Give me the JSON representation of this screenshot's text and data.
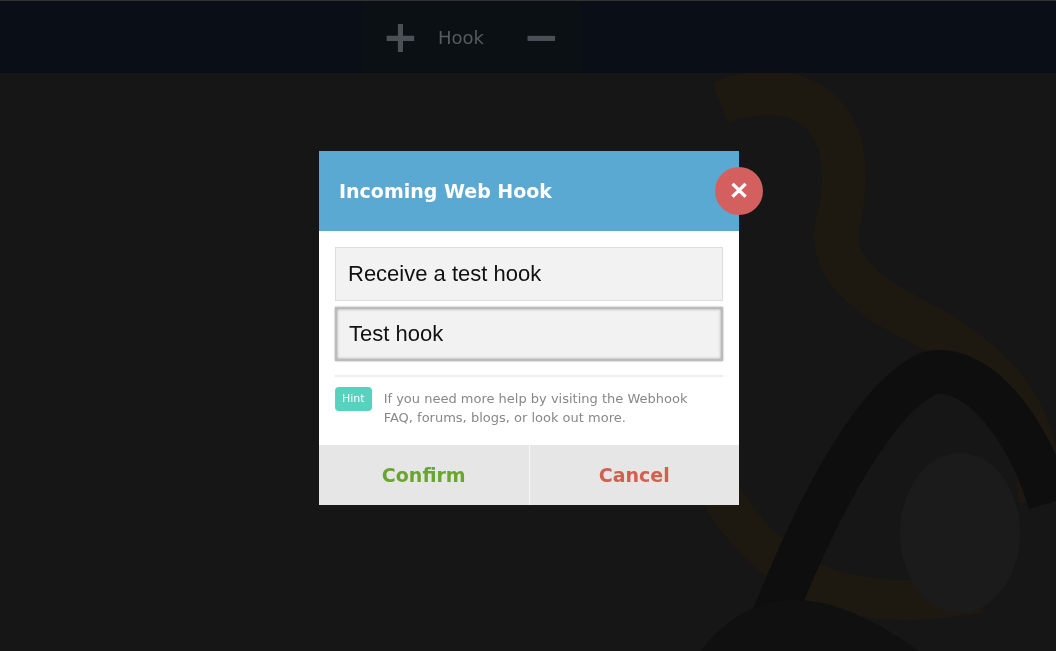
{
  "toolbar": {
    "add": "+",
    "label": "Hook",
    "remove": "−"
  },
  "dialog": {
    "title": "Incoming Web Hook",
    "close": "✕",
    "fields": [
      {
        "value": "Receive a test hook",
        "focused": false
      },
      {
        "value": "Test hook",
        "focused": true
      }
    ],
    "hint": {
      "badge": "Hint",
      "text": "If you need more help by visiting the Webhook FAQ, forums, blogs, or look out more."
    },
    "buttons": [
      {
        "label": "Confirm",
        "kind": "confirm"
      },
      {
        "label": "Cancel",
        "kind": "cancel"
      }
    ]
  }
}
